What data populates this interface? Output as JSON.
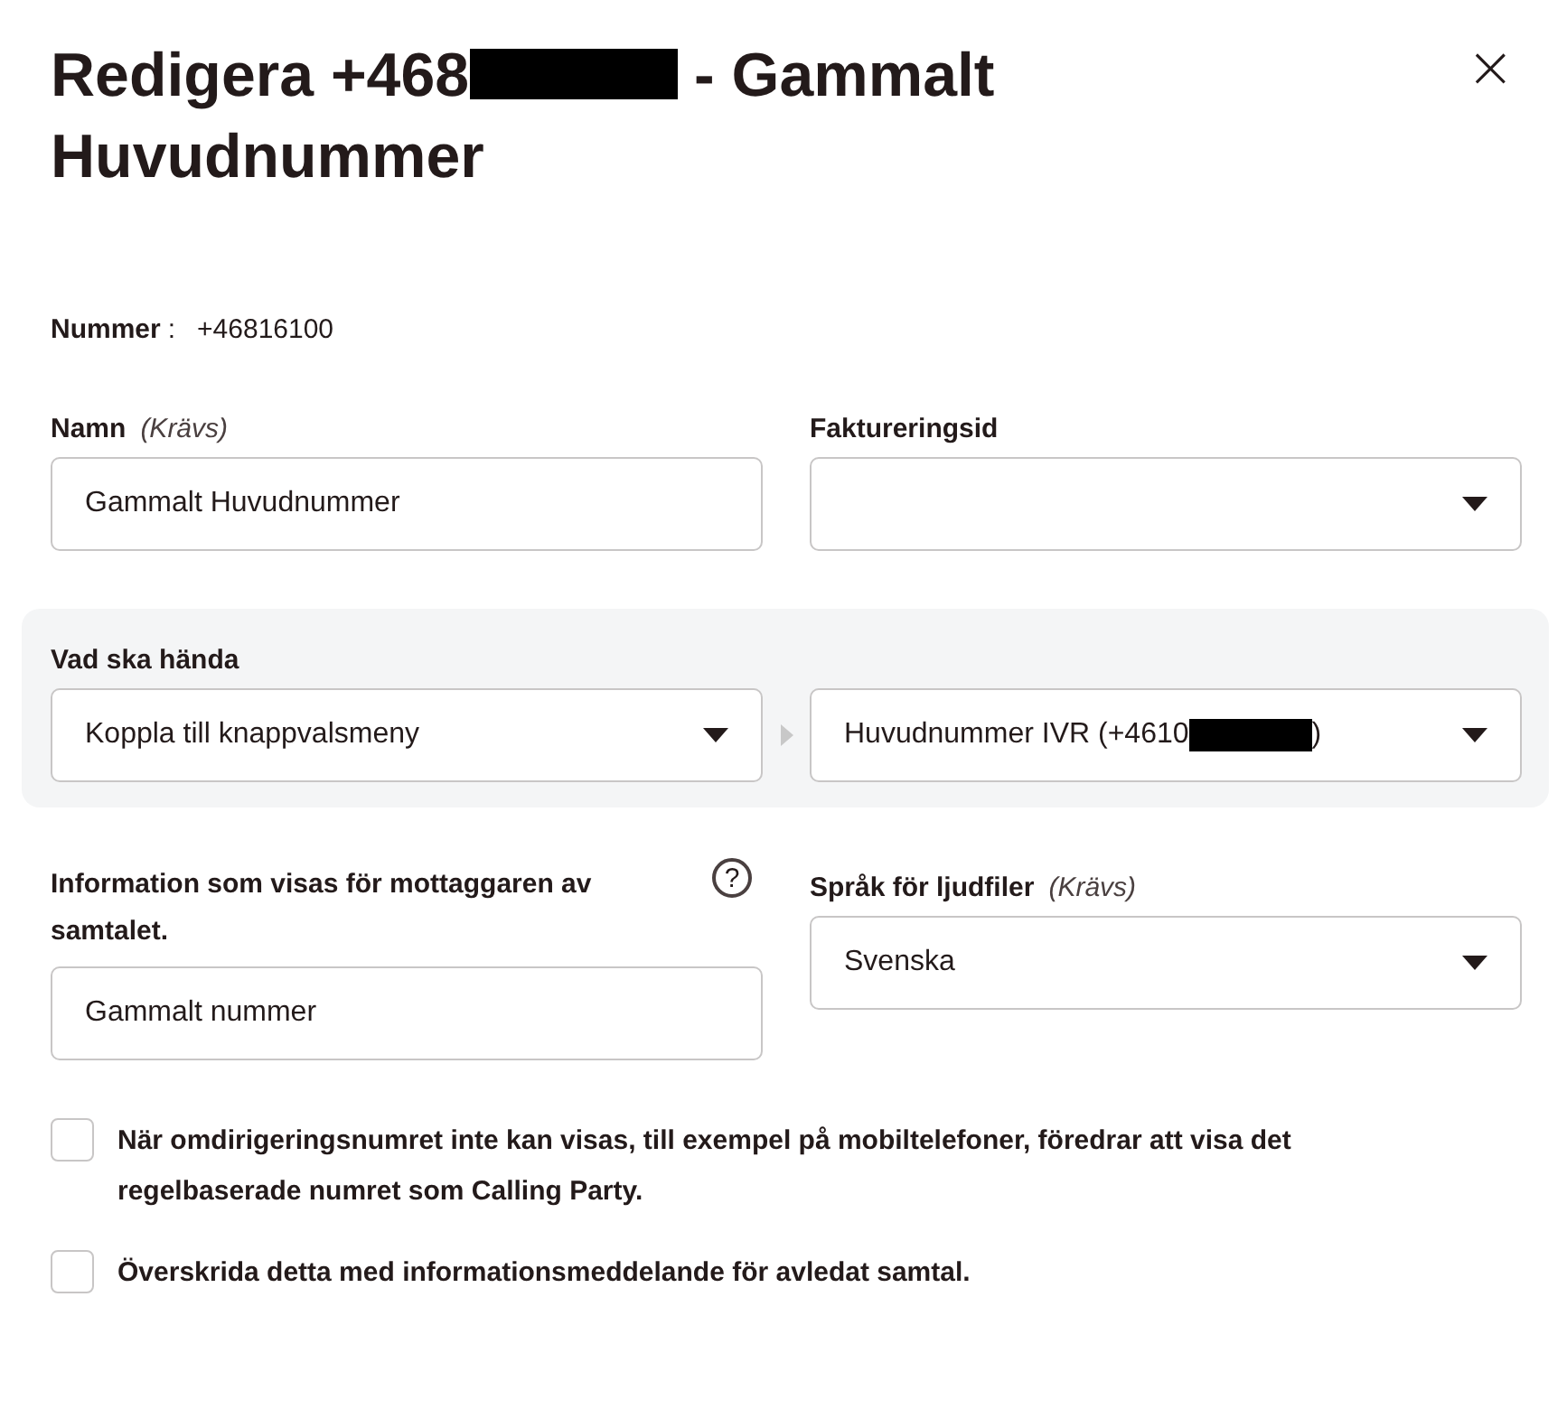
{
  "title": {
    "before": "Redigera +468",
    "after": "- Gammalt",
    "second_line": "Huvudnummer",
    "redacted": true
  },
  "close": "×",
  "number": {
    "label": "Nummer",
    "colon": ":",
    "value": "+46816100"
  },
  "name_field": {
    "label": "Namn",
    "required": "(Krävs)",
    "value": "Gammalt Huvudnummer"
  },
  "billing": {
    "label": "Faktureringsid"
  },
  "action": {
    "label": "Vad ska hända",
    "choice": "Koppla till knappvalsmeny",
    "target_before": "Huvudnummer IVR (+4610",
    "target_after": ")",
    "redacted": true
  },
  "info_field": {
    "label": "Information som visas för mottaggaren av samtalet.",
    "help": "?",
    "value": "Gammalt nummer"
  },
  "language": {
    "label": "Språk för ljudfiler",
    "required": "(Krävs)",
    "value": "Svenska"
  },
  "checkboxes": [
    {
      "label": "När omdirigeringsnumret inte kan visas, till exempel på mobiltelefoner, föredrar att visa det regelbaserade numret som Calling Party.",
      "checked": false
    },
    {
      "label": "Överskrida detta med informationsmeddelande för avledat samtal.",
      "checked": false
    }
  ]
}
